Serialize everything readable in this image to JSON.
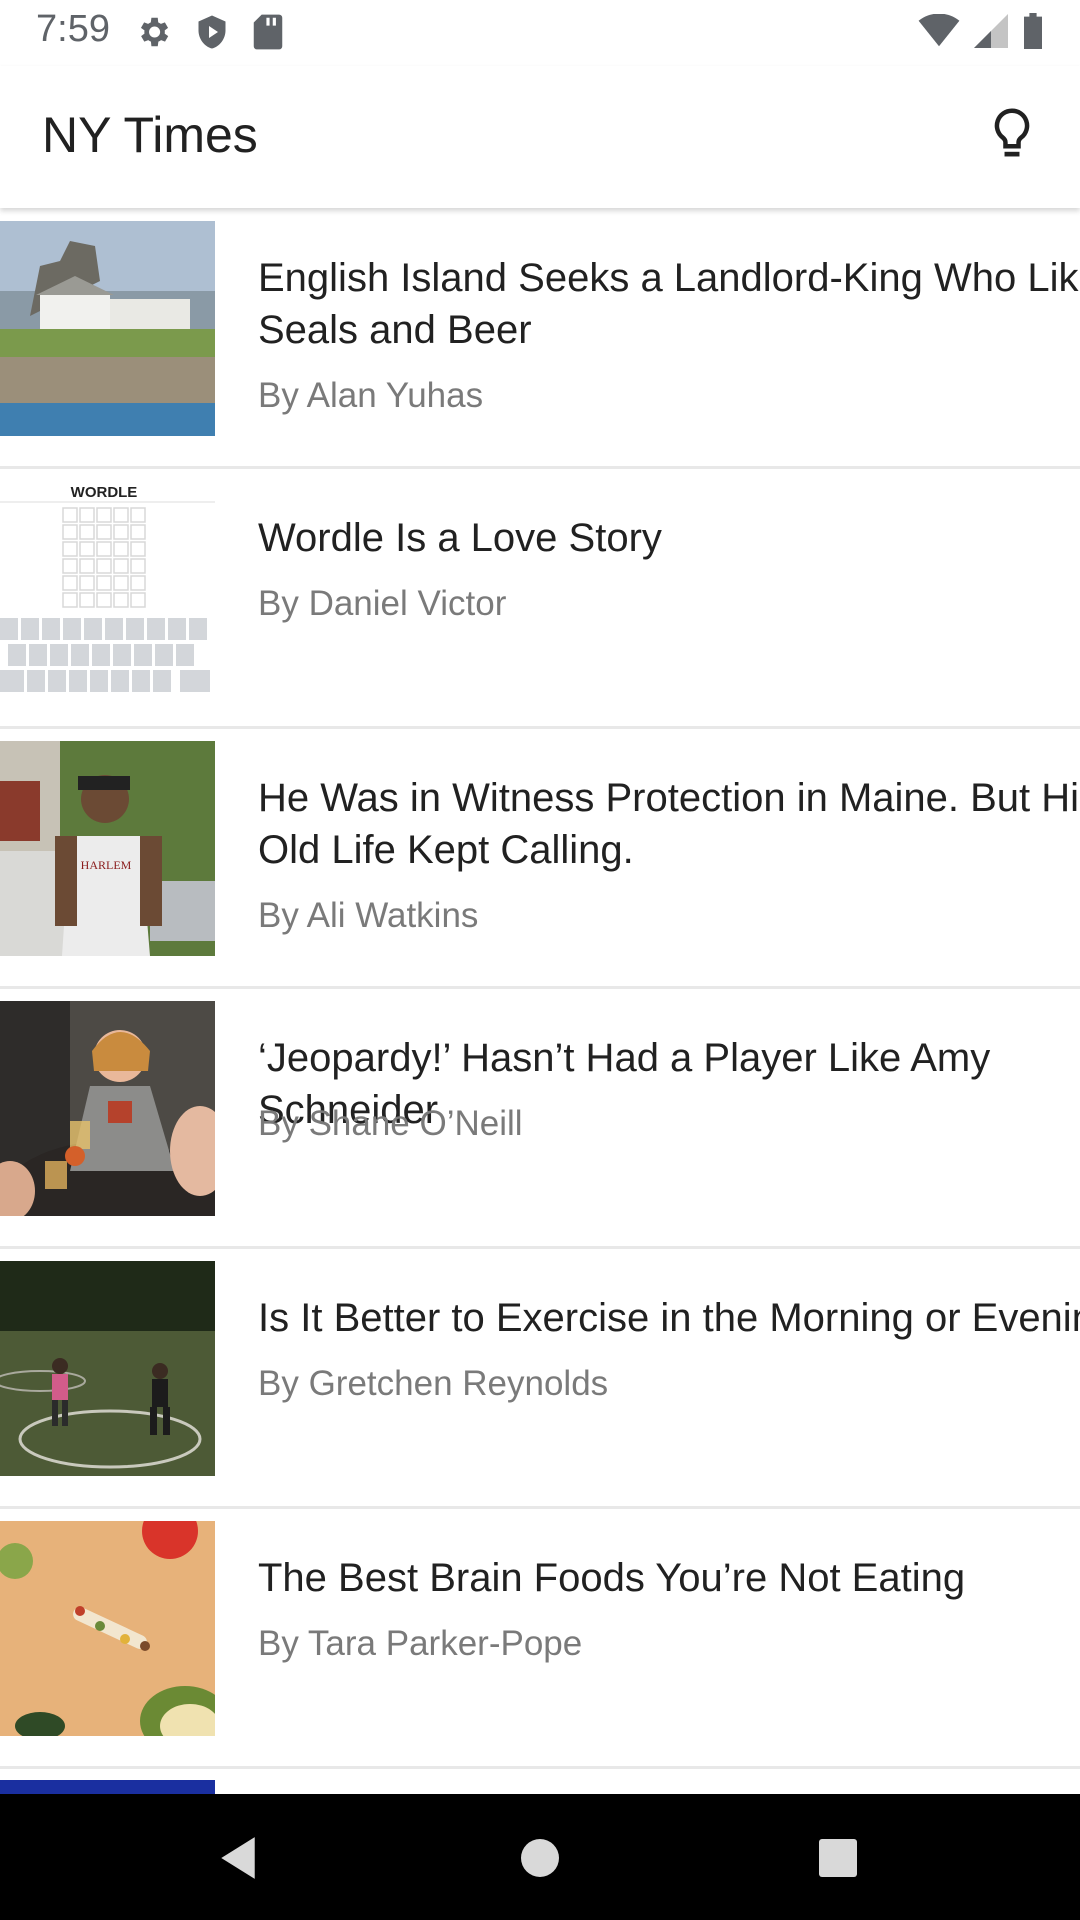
{
  "status_bar": {
    "time": "7:59",
    "left_icons": [
      "gear-icon",
      "shield-icon",
      "sd-card-icon"
    ],
    "right_icons": [
      "wifi-icon",
      "cell-signal-icon",
      "battery-icon"
    ]
  },
  "app_bar": {
    "title": "NY Times",
    "action_icon": "lightbulb-icon"
  },
  "articles": [
    {
      "headline": "English Island Seeks a Landlord-King Who Likes Seals and Beer",
      "byline": "By Alan Yuhas",
      "thumbnail": "island-castle-photo"
    },
    {
      "headline": "Wordle Is a Love Story",
      "byline": "By Daniel Victor",
      "thumbnail": "wordle-game-screenshot",
      "thumbnail_text": "WORDLE"
    },
    {
      "headline": "He Was in Witness Protection in Maine. But His Old Life Kept Calling.",
      "byline": "By Ali Watkins",
      "thumbnail": "man-street-photo",
      "thumbnail_text": "HARLEM"
    },
    {
      "headline": "‘Jeopardy!’ Hasn’t Had a Player Like Amy Schneider",
      "byline": "By Shane O’Neill",
      "thumbnail": "woman-bar-photo"
    },
    {
      "headline": "Is It Better to Exercise in the Morning or Evening?",
      "byline": "By Gretchen Reynolds",
      "thumbnail": "boxing-park-photo"
    },
    {
      "headline": "The Best Brain Foods You’re Not Eating",
      "byline": "By Tara Parker-Pope",
      "thumbnail": "cutting-board-food-photo"
    }
  ],
  "nav_bar": {
    "buttons": [
      "back-icon",
      "home-icon",
      "recents-icon"
    ]
  },
  "colors": {
    "title_text": "#212121",
    "byline_text": "#7a7a7a",
    "divider": "#e8e8e8",
    "nav_background": "#000000",
    "partial_item_accent": "#1a2fa0"
  }
}
